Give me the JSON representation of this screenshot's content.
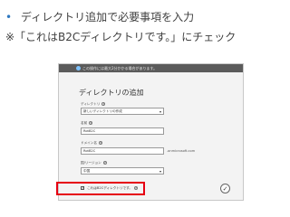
{
  "slide": {
    "bullet": "•",
    "line1": "ディレクトリ追加で必要事項を入力",
    "line2": "※「これはB2Cディレクトリです。」にチェック"
  },
  "dialog": {
    "notice": "この操作には最大2分かかる場合があります。",
    "title": "ディレクトリの追加",
    "fields": {
      "directory_label": "ディレクトリ",
      "directory_value": "新しいディレクトリの作成",
      "name_label": "名前",
      "name_value": "RotB2C",
      "domain_label": "ドメイン名",
      "domain_value": "RotB2C",
      "domain_suffix": ".onmicrosoft.com",
      "region_label": "国/リージョン",
      "region_value": "中国",
      "b2c_checkbox_label": "これはB2Cディレクトリです。",
      "b2c_checked": true
    },
    "ok_glyph": "✓"
  },
  "colors": {
    "bullet": "#2e78c0",
    "highlight": "#e60012"
  }
}
